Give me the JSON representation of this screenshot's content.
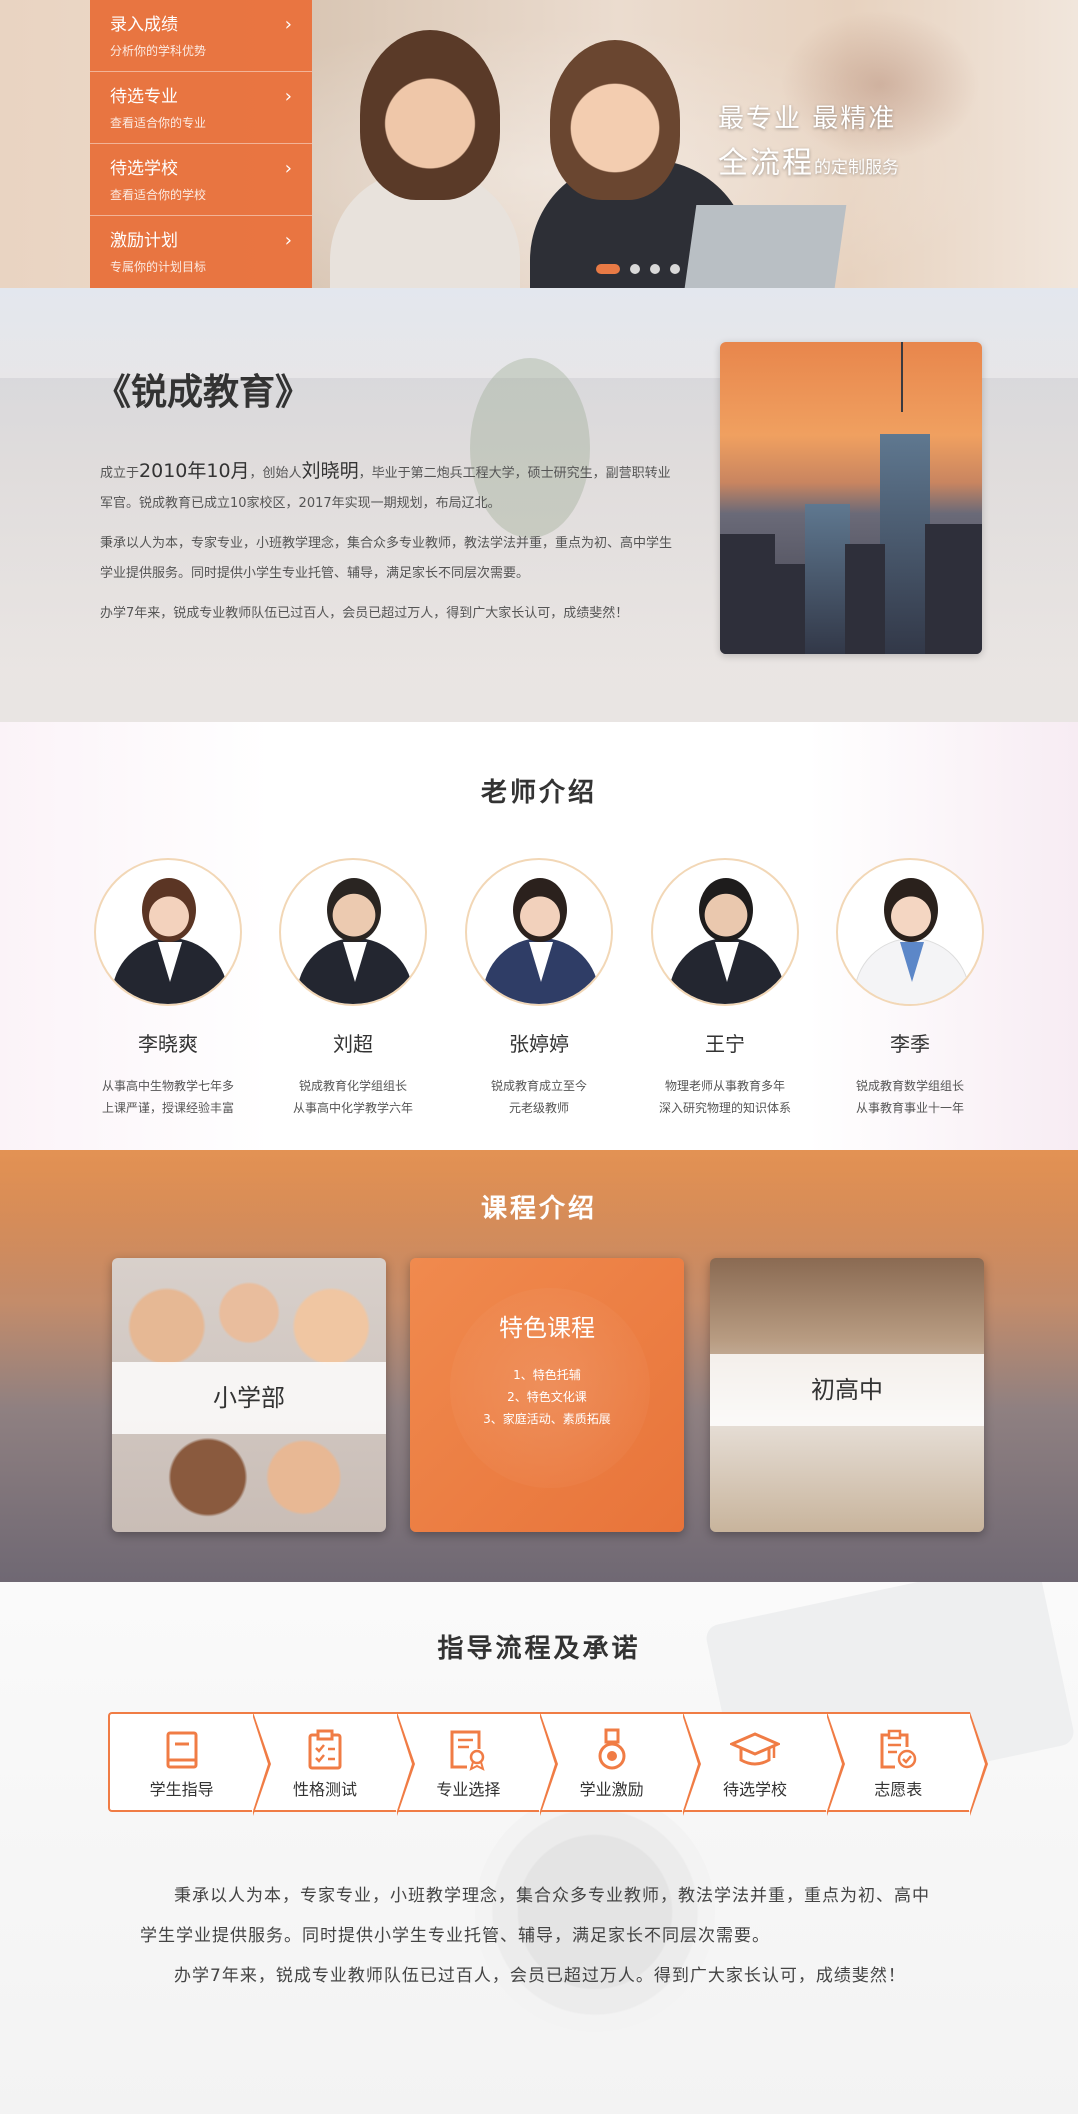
{
  "hero": {
    "menu": [
      {
        "title": "录入成绩",
        "sub": "分析你的学科优势"
      },
      {
        "title": "待选专业",
        "sub": "查看适合你的专业"
      },
      {
        "title": "待选学校",
        "sub": "查看适合你的学校"
      },
      {
        "title": "激励计划",
        "sub": "专属你的计划目标"
      }
    ],
    "arrow": "›",
    "slogan_line1": "最专业  最精准",
    "slogan_big": "全流程",
    "slogan_small": "的定制服务",
    "slides_count": 4,
    "active_slide": 1
  },
  "about": {
    "title": "《锐成教育》",
    "p1_a": "成立于",
    "p1_date": "2010年10月",
    "p1_b": "，创始人",
    "p1_name": "刘晓明",
    "p1_c": "，毕业于第二炮兵工程大学，硕士研究生，副营职转业军官。锐成教育已成立10家校区，2017年实现一期规划，布局辽北。",
    "p2": "秉承以人为本，专家专业，小班教学理念，集合众多专业教师，教法学法并重，重点为初、高中学生学业提供服务。同时提供小学生专业托管、辅导，满足家长不同层次需要。",
    "p3": "办学7年来，锐成专业教师队伍已过百人，会员已超过万人，得到广大家长认可，成绩斐然！"
  },
  "teachers": {
    "title": "老师介绍",
    "items": [
      {
        "name": "李晓爽",
        "desc1": "从事高中生物教学七年多",
        "desc2": "上课严谨，授课经验丰富"
      },
      {
        "name": "刘超",
        "desc1": "锐成教育化学组组长",
        "desc2": "从事高中化学教学六年"
      },
      {
        "name": "张婷婷",
        "desc1": "锐成教育成立至今",
        "desc2": "元老级教师"
      },
      {
        "name": "王宁",
        "desc1": "物理老师从事教育多年",
        "desc2": "深入研究物理的知识体系"
      },
      {
        "name": "李季",
        "desc1": "锐成教育数学组组长",
        "desc2": "从事教育事业十一年"
      }
    ]
  },
  "courses": {
    "title": "课程介绍",
    "primary_label": "小学部",
    "feature_title": "特色课程",
    "feature_items": [
      "1、特色托辅",
      "2、特色文化课",
      "3、家庭活动、素质拓展"
    ],
    "secondary_label": "初高中"
  },
  "process": {
    "title": "指导流程及承诺",
    "steps": [
      {
        "label": "学生指导",
        "icon": "book-icon"
      },
      {
        "label": "性格测试",
        "icon": "clipboard-check-icon"
      },
      {
        "label": "专业选择",
        "icon": "certificate-icon"
      },
      {
        "label": "学业激励",
        "icon": "medal-icon"
      },
      {
        "label": "待选学校",
        "icon": "graduation-cap-icon"
      },
      {
        "label": "志愿表",
        "icon": "form-check-icon"
      }
    ],
    "p1": "秉承以人为本，专家专业，小班教学理念，集合众多专业教师，教法学法并重，重点为初、高中学生学业提供服务。同时提供小学生专业托管、辅导，满足家长不同层次需要。",
    "p2": "办学7年来，锐成专业教师队伍已过百人，会员已超过万人。得到广大家长认可，成绩斐然！"
  },
  "colors": {
    "accent": "#e8703a",
    "accent_light": "#f07c45",
    "avatar_border": "#f2d7b6"
  }
}
